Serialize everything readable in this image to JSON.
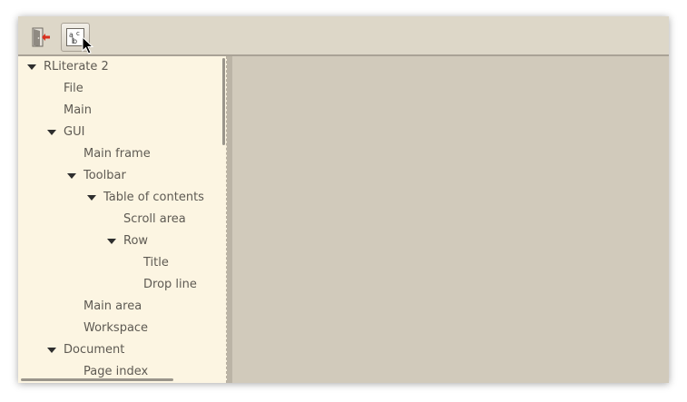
{
  "toolbar": {
    "buttons": [
      {
        "name": "quit-button",
        "icon": "exit-door-icon"
      },
      {
        "name": "toc-button",
        "icon": "abc-text-icon"
      }
    ]
  },
  "toc": {
    "items": [
      {
        "label": "RLiterate 2",
        "depth": 0,
        "expanded": true
      },
      {
        "label": "File",
        "depth": 1,
        "expanded": null
      },
      {
        "label": "Main",
        "depth": 1,
        "expanded": null
      },
      {
        "label": "GUI",
        "depth": 1,
        "expanded": true
      },
      {
        "label": "Main frame",
        "depth": 2,
        "expanded": null
      },
      {
        "label": "Toolbar",
        "depth": 2,
        "expanded": true
      },
      {
        "label": "Table of contents",
        "depth": 3,
        "expanded": true
      },
      {
        "label": "Scroll area",
        "depth": 4,
        "expanded": null
      },
      {
        "label": "Row",
        "depth": 4,
        "expanded": true
      },
      {
        "label": "Title",
        "depth": 5,
        "expanded": null
      },
      {
        "label": "Drop line",
        "depth": 5,
        "expanded": null
      },
      {
        "label": "Main area",
        "depth": 2,
        "expanded": null
      },
      {
        "label": "Workspace",
        "depth": 2,
        "expanded": null
      },
      {
        "label": "Document",
        "depth": 1,
        "expanded": true
      },
      {
        "label": "Page index",
        "depth": 2,
        "expanded": null
      }
    ]
  },
  "colors": {
    "toc_background": "#fcf5e2",
    "workspace_background": "#d1cabb",
    "toolbar_background": "#ddd7c8",
    "text": "#5e5a53"
  }
}
